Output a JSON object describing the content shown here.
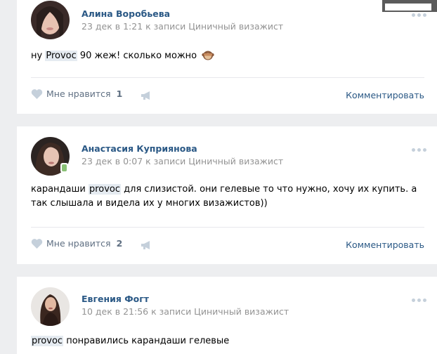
{
  "comments": [
    {
      "author": "Алина Воробьева",
      "meta": "23 дек в 1:21 к записи Циничный визажист",
      "text_before": "ну ",
      "highlight": "Provoc",
      "text_after": " 90 жеж! сколько можно",
      "emoji": "see-no-evil-monkey-icon",
      "like_label": "Мне нравится",
      "like_count": "1",
      "comment_label": "Комментировать"
    },
    {
      "author": "Анастасия Куприянова",
      "meta": "23 дек в 0:07 к записи Циничный визажист",
      "text_before": "карандаши ",
      "highlight": "provoc",
      "text_after": " для слизистой. они гелевые то что нужно, хочу их купить. а так слышала и видела их у многих визажистов))",
      "like_label": "Мне нравится",
      "like_count": "2",
      "comment_label": "Комментировать",
      "online_mobile": true
    },
    {
      "author": "Евгения Фогт",
      "meta": "10 дек в 21:56 к записи Циничный визажист",
      "text_before": "",
      "highlight": "provoc",
      "text_after": " понравились карандаши гелевые"
    }
  ],
  "colors": {
    "link": "#2a5885",
    "meta": "#939393",
    "action": "#5f6f82",
    "icon": "#c5d0db",
    "background": "#edeef0"
  }
}
